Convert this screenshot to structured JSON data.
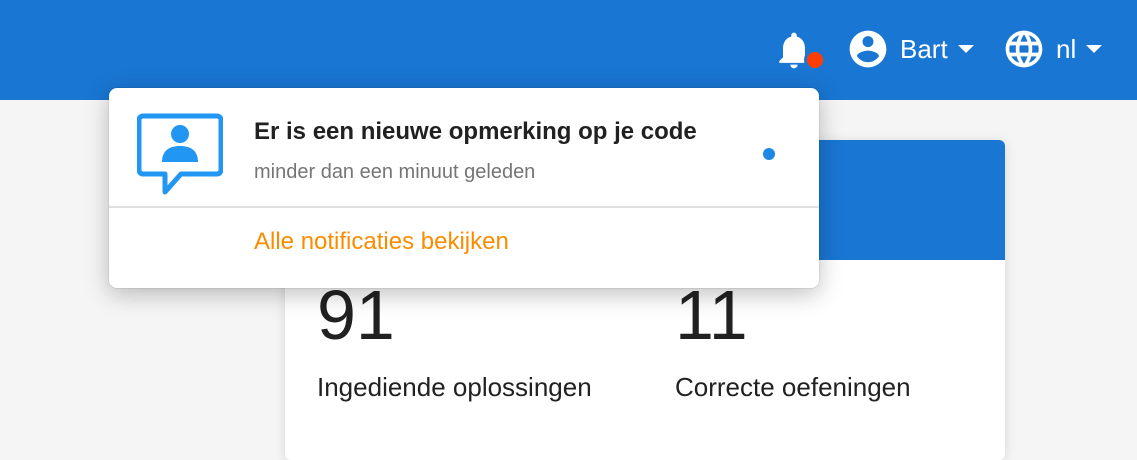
{
  "header": {
    "notifications_badge_color": "#ff3d00",
    "user_name": "Bart",
    "language": "nl",
    "background_color": "#1976d2"
  },
  "notifications": {
    "items": [
      {
        "title": "Er is een nieuwe opmerking op je code",
        "time": "minder dan een minuut geleden",
        "icon": "comment-user-icon",
        "unread": true
      }
    ],
    "view_all_label": "Alle notificaties bekijken",
    "link_color": "#fb8c00"
  },
  "dashboard": {
    "stats": [
      {
        "value": "91",
        "label": "Ingediende oplossingen"
      },
      {
        "value": "11",
        "label": "Correcte oefeningen"
      }
    ]
  }
}
